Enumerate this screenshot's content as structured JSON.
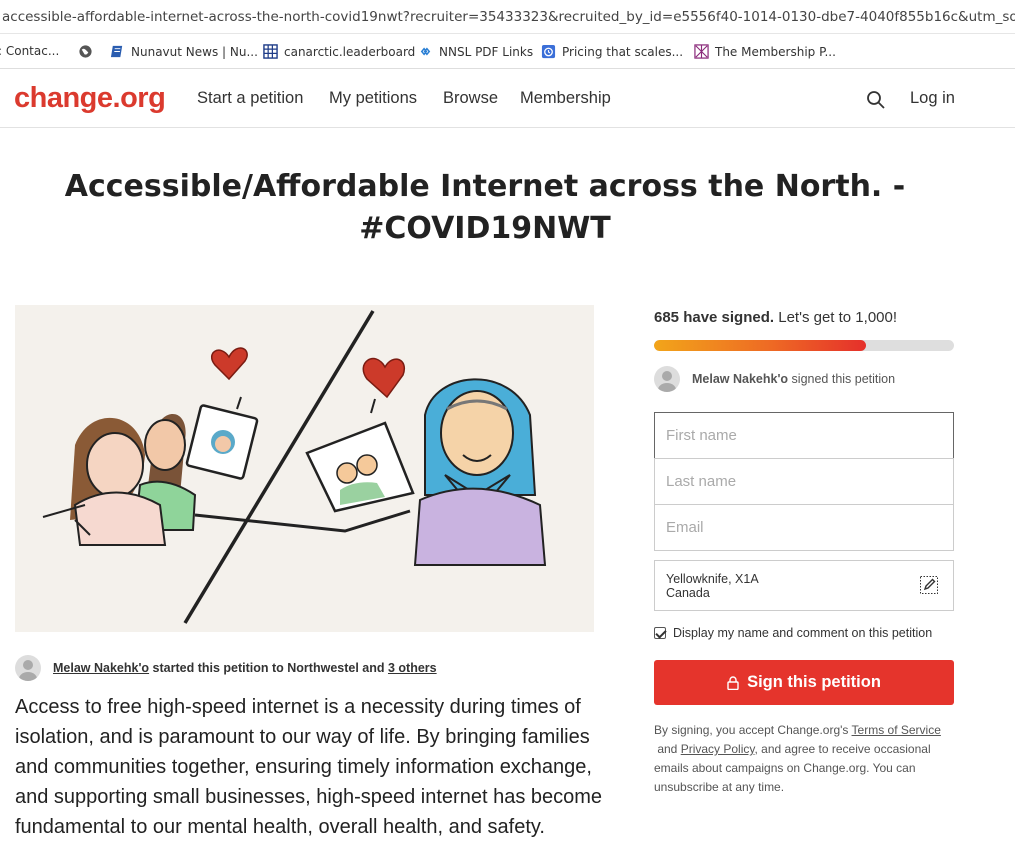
{
  "browser": {
    "url": "accessible-affordable-internet-across-the-north-covid19nwt?recruiter=35433323&recruited_by_id=e5556f40-1014-0130-dbe7-4040f855b16c&utm_source=share_pe"
  },
  "bookmarks": [
    {
      "label": ": Contac...",
      "icon": "contact-icon"
    },
    {
      "label": "",
      "icon": "globe-icon"
    },
    {
      "label": "Nunavut News | Nu...",
      "icon": "news-icon"
    },
    {
      "label": "canarctic.leaderboard",
      "icon": "grid-icon"
    },
    {
      "label": "NNSL PDF Links",
      "icon": "diamond-icon"
    },
    {
      "label": "Pricing that scales...",
      "icon": "clock-icon"
    },
    {
      "label": "The Membership P...",
      "icon": "membership-icon"
    }
  ],
  "nav": {
    "logo": "change.org",
    "links": [
      "Start a petition",
      "My petitions",
      "Browse",
      "Membership"
    ],
    "login": "Log in"
  },
  "petition": {
    "title_line1": "Accessible/Affordable Internet across the North. -",
    "title_line2": "#COVID19NWT",
    "starter_name": "Melaw Nakehk'o",
    "starter_text": " started this petition to Northwestel and ",
    "starter_others": "3 others",
    "body": "Access to free high-speed internet is a necessity during times of isolation, and is paramount to our way of life. By bringing families and communities together, ensuring timely information exchange, and supporting small businesses, high-speed internet has become fundamental to our mental health, overall health, and safety."
  },
  "signature": {
    "count_text": "685 have signed.",
    "goal_text": " Let's get to 1,000!",
    "progress_fraction": 0.705,
    "recent_signer": "Melaw Nakehk'o",
    "recent_text": " signed this petition",
    "first_name_placeholder": "First name",
    "last_name_placeholder": "Last name",
    "email_placeholder": "Email",
    "location_line1": "Yellowknife, X1A",
    "location_line2": "Canada",
    "consent_label": "Display my name and comment on this petition",
    "sign_button": "Sign this petition",
    "legal_prefix": "By signing, you accept Change.org's ",
    "terms_link": "Terms of Service",
    "legal_and": " and ",
    "privacy_link": "Privacy Policy",
    "legal_suffix": ", and agree to receive occasional emails about campaigns on Change.org. You can unsubscribe at any time."
  },
  "colors": {
    "brand": "#db3a2e",
    "button": "#e5342c",
    "progress_start": "#f2a51a",
    "progress_end": "#e5302b"
  }
}
